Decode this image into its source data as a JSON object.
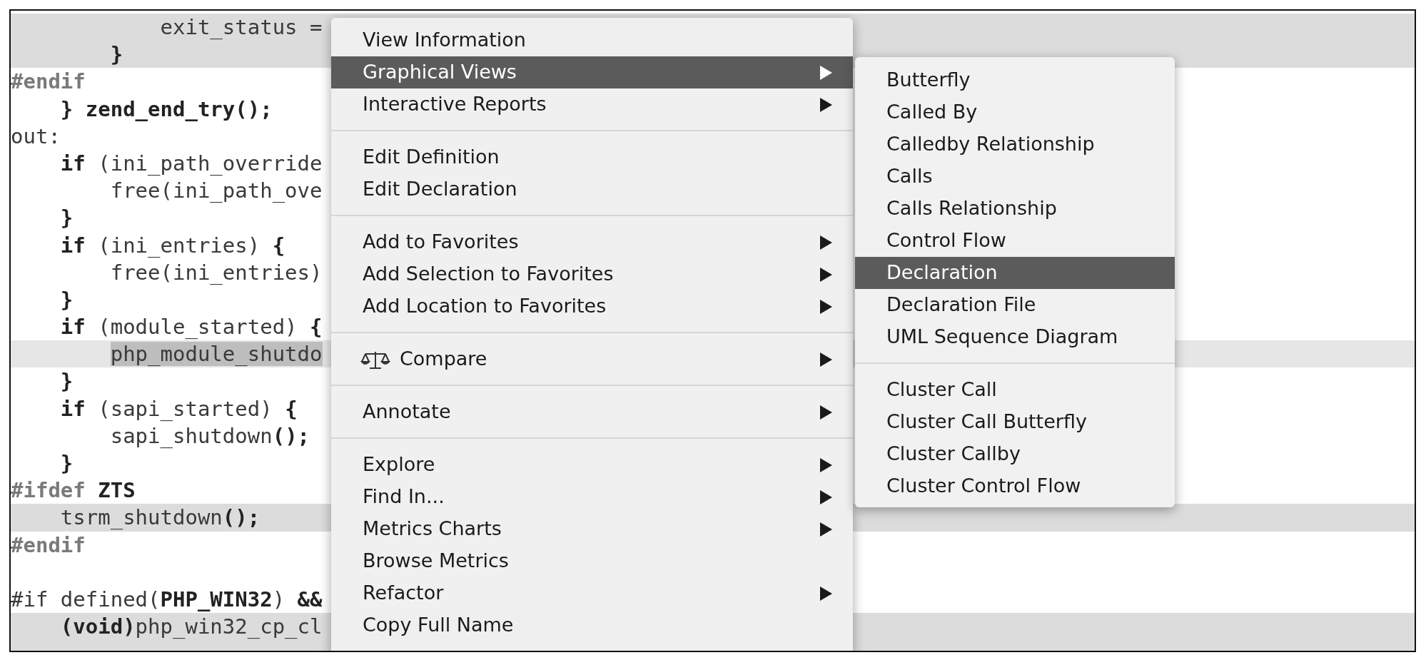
{
  "code_lines": [
    {
      "text": "            exit_status =",
      "highlighted": true,
      "selected": false,
      "kind": "code"
    },
    {
      "text": "        **}**",
      "highlighted": true,
      "selected": false,
      "kind": "code"
    },
    {
      "text": "#endif",
      "highlighted": false,
      "selected": false,
      "kind": "preprocessor"
    },
    {
      "text": "    **} zend_end_try();**",
      "highlighted": false,
      "selected": false,
      "kind": "code"
    },
    {
      "text": "out:",
      "highlighted": false,
      "selected": false,
      "kind": "code"
    },
    {
      "text": "    **if** (ini_path_override",
      "highlighted": false,
      "selected": false,
      "kind": "code"
    },
    {
      "text": "        free(ini_path_ove",
      "highlighted": false,
      "selected": false,
      "kind": "code"
    },
    {
      "text": "    **}**",
      "highlighted": false,
      "selected": false,
      "kind": "code"
    },
    {
      "text": "    **if** (ini_entries) **{**",
      "highlighted": false,
      "selected": false,
      "kind": "code"
    },
    {
      "text": "        free(ini_entries)",
      "highlighted": false,
      "selected": false,
      "kind": "code"
    },
    {
      "text": "    **}**",
      "highlighted": false,
      "selected": false,
      "kind": "code"
    },
    {
      "text": "    **if** (module_started) **{**",
      "highlighted": false,
      "selected": false,
      "kind": "code"
    },
    {
      "text": "        php_module_shutdo",
      "highlighted": true,
      "selected": true,
      "kind": "code"
    },
    {
      "text": "    **}**",
      "highlighted": false,
      "selected": false,
      "kind": "code"
    },
    {
      "text": "    **if** (sapi_started) **{**",
      "highlighted": false,
      "selected": false,
      "kind": "code"
    },
    {
      "text": "        sapi_shutdown**();**",
      "highlighted": false,
      "selected": false,
      "kind": "code"
    },
    {
      "text": "    **}**",
      "highlighted": false,
      "selected": false,
      "kind": "code"
    },
    {
      "text": "#ifdef **ZTS**",
      "highlighted": false,
      "selected": false,
      "kind": "preprocessor"
    },
    {
      "text": "    tsrm_shutdown**();**",
      "highlighted": true,
      "selected": false,
      "kind": "code"
    },
    {
      "text": "#endif",
      "highlighted": false,
      "selected": false,
      "kind": "preprocessor"
    },
    {
      "highlighted": false
    },
    {
      "text": "#if defined(**PHP_WIN32**) **&&**",
      "highlighted": false,
      "selected": false,
      "kind": "code"
    },
    {
      "text": "    **(void)**php_win32_cp_cl",
      "highlighted": true,
      "selected": false,
      "kind": "code"
    },
    {
      "highlighted": true
    }
  ],
  "context_menu": {
    "groups": [
      [
        {
          "label": "View Information",
          "submenu": false,
          "selected": false
        },
        {
          "label": "Graphical Views",
          "submenu": true,
          "selected": true
        },
        {
          "label": "Interactive Reports",
          "submenu": true,
          "selected": false
        }
      ],
      [
        {
          "label": "Edit Definition",
          "submenu": false,
          "selected": false
        },
        {
          "label": "Edit Declaration",
          "submenu": false,
          "selected": false
        }
      ],
      [
        {
          "label": "Add to Favorites",
          "submenu": true,
          "selected": false
        },
        {
          "label": "Add Selection to Favorites",
          "submenu": true,
          "selected": false
        },
        {
          "label": "Add Location to Favorites",
          "submenu": true,
          "selected": false
        }
      ],
      [
        {
          "label": "Compare",
          "submenu": true,
          "selected": false,
          "has_icon": true
        }
      ],
      [
        {
          "label": "Annotate",
          "submenu": true,
          "selected": false
        }
      ],
      [
        {
          "label": "Explore",
          "submenu": true,
          "selected": false
        },
        {
          "label": "Find In...",
          "submenu": true,
          "selected": false
        },
        {
          "label": "Metrics Charts",
          "submenu": true,
          "selected": false
        },
        {
          "label": "Browse Metrics",
          "submenu": false,
          "selected": false
        },
        {
          "label": "Refactor",
          "submenu": true,
          "selected": false
        },
        {
          "label": "Copy Full Name",
          "submenu": false,
          "selected": false
        }
      ]
    ]
  },
  "submenu": {
    "groups": [
      [
        {
          "label": "Butterfly",
          "selected": false
        },
        {
          "label": "Called By",
          "selected": false
        },
        {
          "label": "Calledby Relationship",
          "selected": false
        },
        {
          "label": "Calls",
          "selected": false
        },
        {
          "label": "Calls Relationship",
          "selected": false
        },
        {
          "label": "Control Flow",
          "selected": false
        },
        {
          "label": "Declaration",
          "selected": true
        },
        {
          "label": "Declaration File",
          "selected": false
        },
        {
          "label": "UML Sequence Diagram",
          "selected": false
        }
      ],
      [
        {
          "label": "Cluster Call",
          "selected": false
        },
        {
          "label": "Cluster Call Butterfly",
          "selected": false
        },
        {
          "label": "Cluster Callby",
          "selected": false
        },
        {
          "label": "Cluster Control Flow",
          "selected": false
        }
      ]
    ]
  }
}
